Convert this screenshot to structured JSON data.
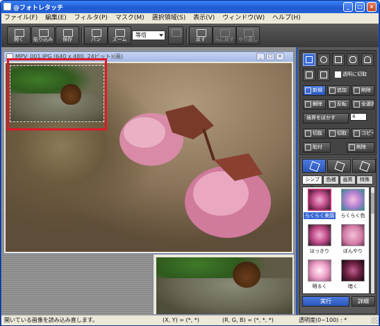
{
  "window": {
    "title": "@フォトレタッチ",
    "buttons": {
      "minimize": "_",
      "maximize": "□",
      "close": "×"
    }
  },
  "menu": [
    "ファイル(F)",
    "編集(E)",
    "フィルタ(P)",
    "マスク(M)",
    "選択領域(S)",
    "表示(V)",
    "ウィンドウ(W)",
    "ヘルプ(H)"
  ],
  "toolbar": {
    "buttons": [
      {
        "label": "開く",
        "icon": "open-icon",
        "enabled": true
      },
      {
        "label": "貼り込み",
        "icon": "paste-icon",
        "enabled": true
      },
      {
        "label": "保存",
        "icon": "save-icon",
        "enabled": true
      },
      {
        "label": "パン",
        "icon": "pan-icon",
        "enabled": true
      },
      {
        "label": "ズーム",
        "icon": "zoom-icon",
        "enabled": true
      },
      {
        "label": "戻す",
        "icon": "revert-icon",
        "enabled": true
      },
      {
        "label": "元に戻す",
        "icon": "undo-icon",
        "enabled": false
      },
      {
        "label": "やり直し",
        "icon": "redo-icon",
        "enabled": false
      }
    ],
    "zoom_value": "等倍"
  },
  "document1": {
    "title": "MPV_001.JPG (640 x 480, 24ビット)(画)"
  },
  "right_panel": {
    "transparent_label": "透明に切取",
    "buttons_row1": [
      "新規",
      "追加",
      "削除"
    ],
    "buttons_row2": [
      "解除",
      "反転",
      "全選択"
    ],
    "feather_label": "境界をぼかす",
    "feather_value": "4",
    "buttons_row3": [
      "切抜",
      "切取",
      "コピー"
    ],
    "buttons_row4": [
      "貼付",
      "削除"
    ]
  },
  "filter_panel": {
    "subtabs": [
      "シンプル",
      "色補",
      "画質",
      "特殊"
    ],
    "items": [
      {
        "label": "らくらく美調",
        "selected": true
      },
      {
        "label": "らくらく色",
        "selected": false
      },
      {
        "label": "はっきり",
        "selected": false
      },
      {
        "label": "ぼんやり",
        "selected": false
      },
      {
        "label": "明るく",
        "selected": false
      },
      {
        "label": "暗く",
        "selected": false
      }
    ],
    "apply_label": "実行",
    "settings_label": "詳細"
  },
  "status": {
    "message": "開いている画像を読み込み直します。",
    "coords": "(X, Y) = (*, *)",
    "rgb": "(R, G, B) = (*, *, *)",
    "transparency": "透明度(0~100) : *"
  }
}
